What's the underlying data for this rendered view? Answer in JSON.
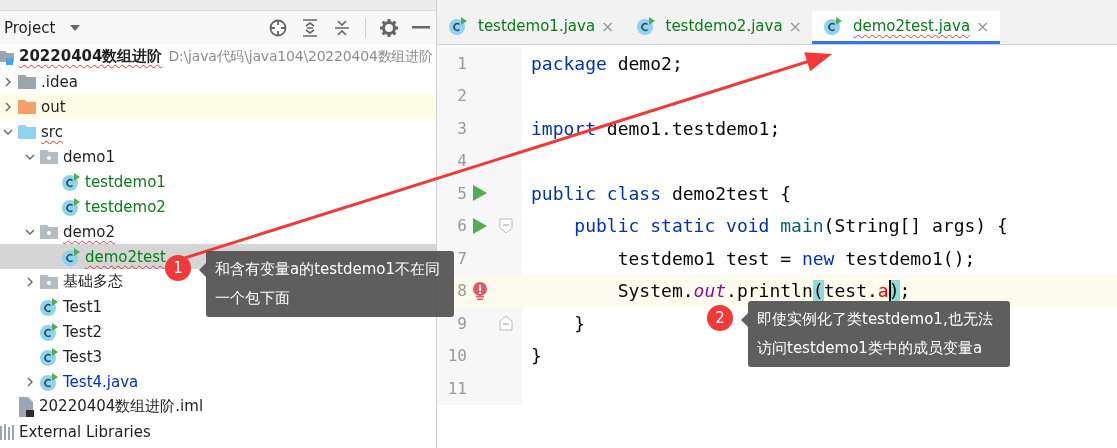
{
  "project_panel": {
    "title": "Project",
    "tree": [
      {
        "label": "20220404数组进阶",
        "path": "D:\\java代码\\java104\\20220404数组进阶",
        "kind": "module",
        "selected": false,
        "highlighted": false,
        "squiggly": true,
        "color": "#1f1f1f",
        "children": [
          {
            "label": ".idea",
            "kind": "folder",
            "expanded": false,
            "selected": false,
            "highlighted": false,
            "squiggly": false,
            "color": "#1f1f1f"
          },
          {
            "label": "out",
            "kind": "excluded-folder",
            "expanded": false,
            "selected": false,
            "highlighted": true,
            "squiggly": false,
            "color": "#1f1f1f"
          },
          {
            "label": "src",
            "kind": "source-folder",
            "expanded": true,
            "selected": false,
            "highlighted": false,
            "squiggly": true,
            "color": "#1f1f1f",
            "children": [
              {
                "label": "demo1",
                "kind": "package",
                "expanded": true,
                "selected": false,
                "highlighted": false,
                "squiggly": false,
                "color": "#1f1f1f",
                "children": [
                  {
                    "label": "testdemo1",
                    "kind": "class",
                    "selected": false,
                    "highlighted": false,
                    "squiggly": false,
                    "color": "#067d17"
                  },
                  {
                    "label": "testdemo2",
                    "kind": "class",
                    "selected": false,
                    "highlighted": false,
                    "squiggly": false,
                    "color": "#067d17"
                  }
                ]
              },
              {
                "label": "demo2",
                "kind": "package",
                "expanded": true,
                "selected": false,
                "highlighted": false,
                "squiggly": true,
                "color": "#1f1f1f",
                "children": [
                  {
                    "label": "demo2test",
                    "kind": "class",
                    "selected": true,
                    "highlighted": false,
                    "squiggly": true,
                    "color": "#067d17"
                  }
                ]
              },
              {
                "label": "基础多态",
                "kind": "package",
                "expanded": false,
                "selected": false,
                "highlighted": false,
                "squiggly": false,
                "color": "#1f1f1f"
              },
              {
                "label": "Test1",
                "kind": "class",
                "selected": false,
                "highlighted": false,
                "squiggly": false,
                "color": "#1f1f1f"
              },
              {
                "label": "Test2",
                "kind": "class",
                "selected": false,
                "highlighted": false,
                "squiggly": false,
                "color": "#1f1f1f"
              },
              {
                "label": "Test3",
                "kind": "class",
                "selected": false,
                "highlighted": false,
                "squiggly": false,
                "color": "#1f1f1f"
              },
              {
                "label": "Test4.java",
                "kind": "class",
                "expanded": false,
                "selected": false,
                "highlighted": false,
                "squiggly": false,
                "color": "#0032c8"
              }
            ]
          },
          {
            "label": "20220404数组进阶.iml",
            "kind": "iml-file",
            "selected": false,
            "highlighted": false,
            "squiggly": false,
            "color": "#1f1f1f"
          }
        ]
      },
      {
        "label": "External Libraries",
        "kind": "library",
        "selected": false,
        "highlighted": false,
        "squiggly": false,
        "color": "#1f1f1f"
      }
    ]
  },
  "editor": {
    "tabs": [
      {
        "label": "testdemo1.java",
        "selected": false,
        "squiggly": false,
        "color": "#067d17",
        "close": "×"
      },
      {
        "label": "testdemo2.java",
        "selected": false,
        "squiggly": false,
        "color": "#067d17",
        "close": "×"
      },
      {
        "label": "demo2test.java",
        "selected": true,
        "squiggly": true,
        "color": "#067d17",
        "close": "×"
      }
    ],
    "lines": [
      {
        "number": "1",
        "run": false,
        "fold_start": false,
        "fold_end": false,
        "error": false,
        "current": false,
        "tokens": [
          {
            "kind": "keyword",
            "text": "package"
          },
          {
            "kind": "plain",
            "text": " demo2;"
          }
        ]
      },
      {
        "number": "2",
        "run": false,
        "fold_start": false,
        "fold_end": false,
        "error": false,
        "current": false
      },
      {
        "number": "3",
        "run": false,
        "fold_start": false,
        "fold_end": false,
        "error": false,
        "current": false,
        "tokens": [
          {
            "kind": "keyword",
            "text": "import"
          },
          {
            "kind": "plain",
            "text": " demo1.testdemo1;"
          }
        ]
      },
      {
        "number": "4",
        "run": false,
        "fold_start": false,
        "fold_end": false,
        "error": false,
        "current": false
      },
      {
        "number": "5",
        "run": true,
        "fold_start": false,
        "fold_end": false,
        "error": false,
        "current": false,
        "tokens": [
          {
            "kind": "keyword",
            "text": "public class"
          },
          {
            "kind": "plain",
            "text": " demo2test {"
          }
        ]
      },
      {
        "number": "6",
        "run": true,
        "fold_start": true,
        "fold_end": false,
        "error": false,
        "current": false,
        "tokens": [
          {
            "kind": "keyword",
            "text": "    public static void"
          },
          {
            "kind": "method",
            "text": " main"
          },
          {
            "kind": "plain",
            "text": "(String[] args) {"
          }
        ]
      },
      {
        "number": "7",
        "run": false,
        "fold_start": false,
        "fold_end": false,
        "error": false,
        "current": false,
        "tokens": [
          {
            "kind": "plain",
            "text": "        testdemo1 test = "
          },
          {
            "kind": "keyword",
            "text": "new"
          },
          {
            "kind": "plain",
            "text": " testdemo1();"
          }
        ]
      },
      {
        "number": "8",
        "run": false,
        "fold_start": false,
        "fold_end": false,
        "error": true,
        "current": true,
        "tokens": [
          {
            "kind": "plain",
            "text": "        System."
          },
          {
            "kind": "static",
            "text": "out"
          },
          {
            "kind": "plain",
            "text": ".println"
          },
          {
            "kind": "brace-match",
            "text": "("
          },
          {
            "kind": "plain",
            "text": "test."
          },
          {
            "kind": "unresolved",
            "text": "a"
          },
          {
            "kind": "brace-match",
            "text": ")",
            "caret_before": true
          },
          {
            "kind": "plain",
            "text": ";"
          }
        ]
      },
      {
        "number": "9",
        "run": false,
        "fold_start": false,
        "fold_end": true,
        "error": false,
        "current": false,
        "tokens": [
          {
            "kind": "plain",
            "text": "    }"
          }
        ]
      },
      {
        "number": "10",
        "run": false,
        "fold_start": false,
        "fold_end": false,
        "error": false,
        "current": false,
        "tokens": [
          {
            "kind": "plain",
            "text": "}"
          }
        ]
      },
      {
        "number": "11",
        "run": false,
        "fold_start": false,
        "fold_end": false,
        "error": false,
        "current": false
      }
    ]
  },
  "annotations": [
    {
      "number": "1",
      "text": "和含有变量a的testdemo1不在同一个包下面"
    },
    {
      "number": "2",
      "text": "即使实例化了类testdemo1,也无法访问testdemo1类中的成员变量a"
    }
  ]
}
